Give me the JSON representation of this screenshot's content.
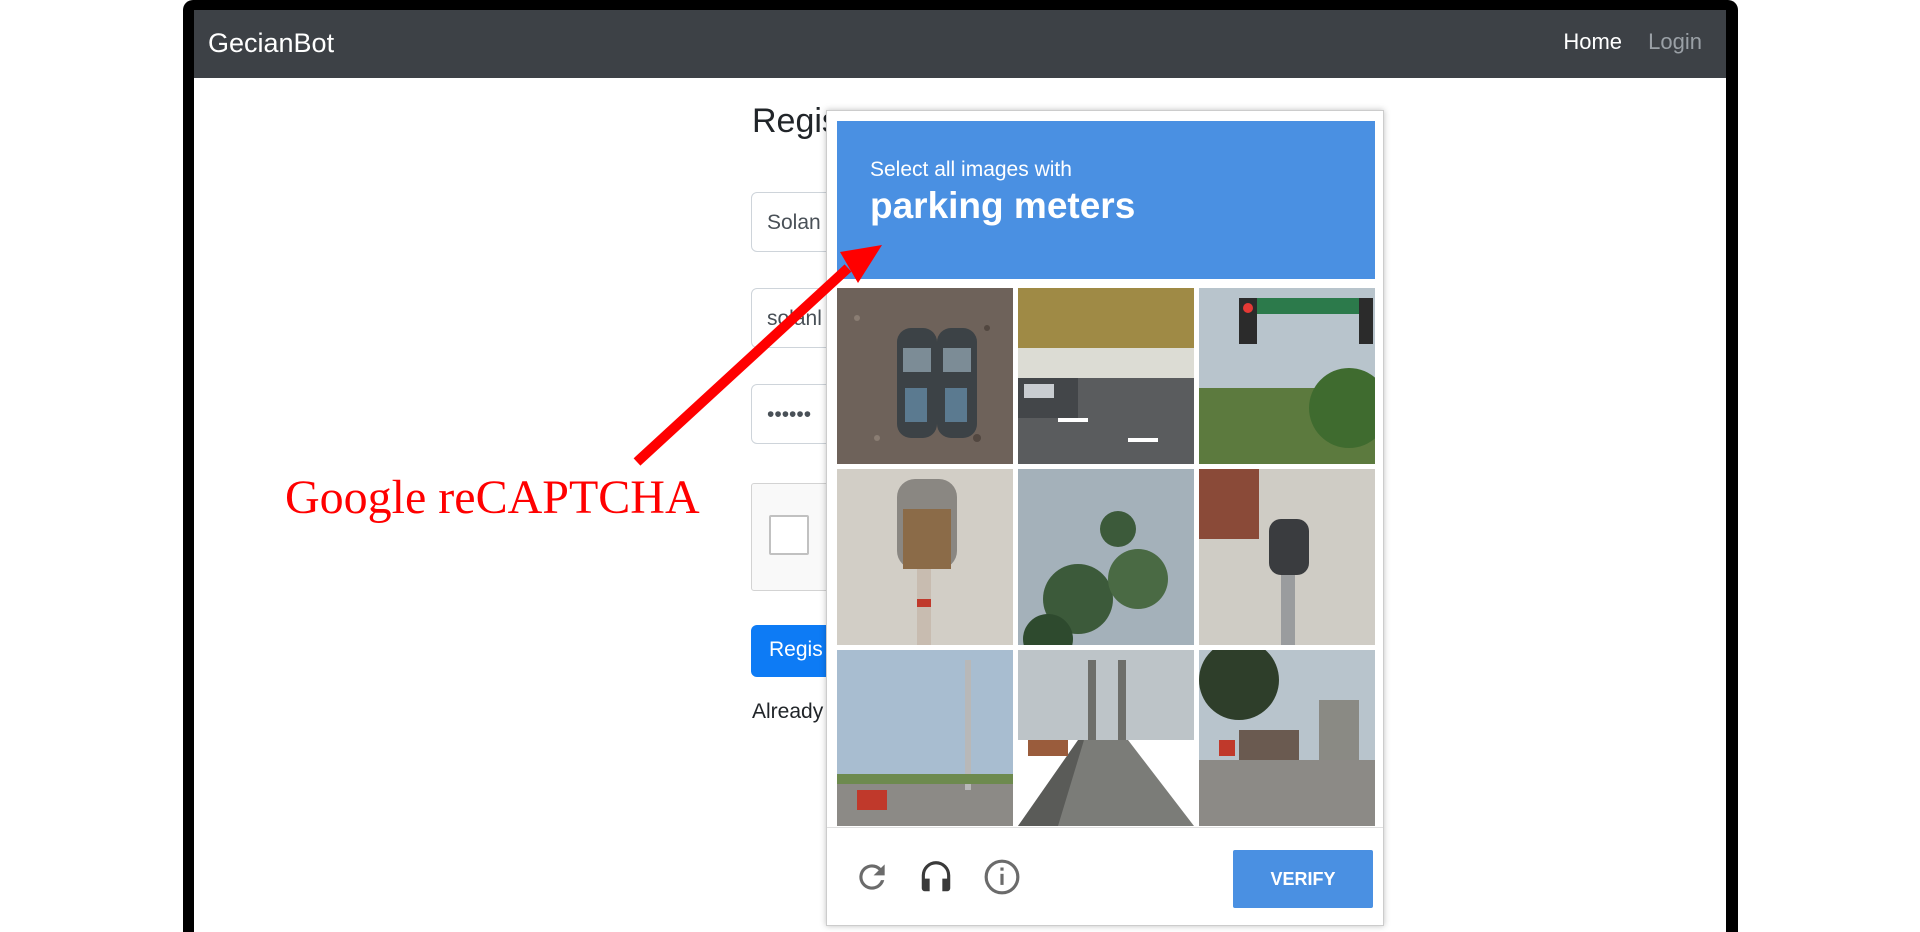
{
  "navbar": {
    "brand": "GecianBot",
    "links": [
      "Home",
      "Login"
    ]
  },
  "form": {
    "title": "Regis",
    "fields": [
      {
        "value": "Solan"
      },
      {
        "value": "solanl"
      },
      {
        "value": "••••••"
      }
    ],
    "register_button": "Regis",
    "already_text": "Already"
  },
  "captcha": {
    "instruction_line1": "Select all images with",
    "instruction_line2": "parking meters",
    "tiles": [
      {
        "name": "parking-meters-tile"
      },
      {
        "name": "highway-truck-tile"
      },
      {
        "name": "traffic-light-street-sign-tile"
      },
      {
        "name": "parking-meter-closeup-tile"
      },
      {
        "name": "pine-tree-tile"
      },
      {
        "name": "parking-meter-sidewalk-tile"
      },
      {
        "name": "utility-pole-street-tile"
      },
      {
        "name": "bridge-road-tile"
      },
      {
        "name": "roadside-signs-tile"
      }
    ],
    "verify_label": "VERIFY",
    "footer_icons": [
      "reload-icon",
      "headphones-icon",
      "info-icon"
    ],
    "header_color": "#4a90e2"
  },
  "annotation": {
    "label": "Google reCAPTCHA",
    "color": "#ff0000"
  }
}
